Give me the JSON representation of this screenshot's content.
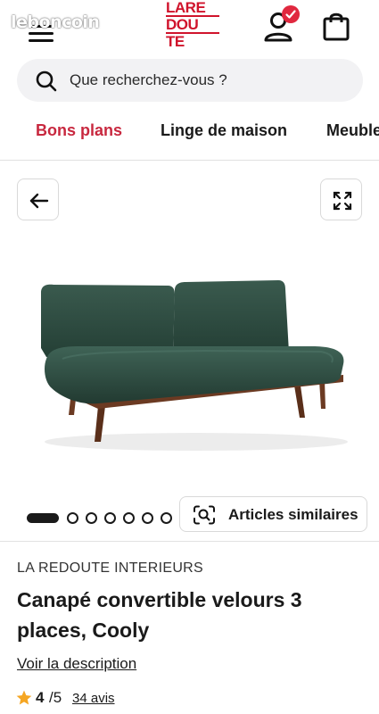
{
  "watermark": "leboncoin",
  "logo": {
    "lines": [
      "LARE",
      "DOU",
      "TE"
    ],
    "color": "#d0142c"
  },
  "header": {
    "menu_icon": "hamburger-menu-icon",
    "account_icon": "user-account-icon",
    "badge_icon": "check-icon",
    "cart_icon": "shopping-bag-icon"
  },
  "search": {
    "placeholder": "Que recherchez-vous ?",
    "icon": "search-icon"
  },
  "categories": [
    {
      "label": "Bons plans",
      "active": true
    },
    {
      "label": "Linge de maison",
      "active": false
    },
    {
      "label": "Meuble",
      "active": false
    }
  ],
  "gallery": {
    "back_icon": "arrow-left-icon",
    "fullscreen_icon": "expand-icon",
    "image": "sofa-image",
    "dots_total": 7,
    "dots_active": 1
  },
  "similar": {
    "label": "Articles similaires",
    "icon": "image-search-icon"
  },
  "product": {
    "brand": "LA REDOUTE INTERIEURS",
    "title": "Canapé convertible velours 3 places, Cooly",
    "description_link": "Voir la description",
    "rating_value": "4",
    "rating_max": "/5",
    "rating_count": "34 avis"
  },
  "colors": {
    "accent": "#c8283f",
    "star": "#f5a623",
    "sofa": "#2c4a3f",
    "wood": "#6b3a22"
  }
}
